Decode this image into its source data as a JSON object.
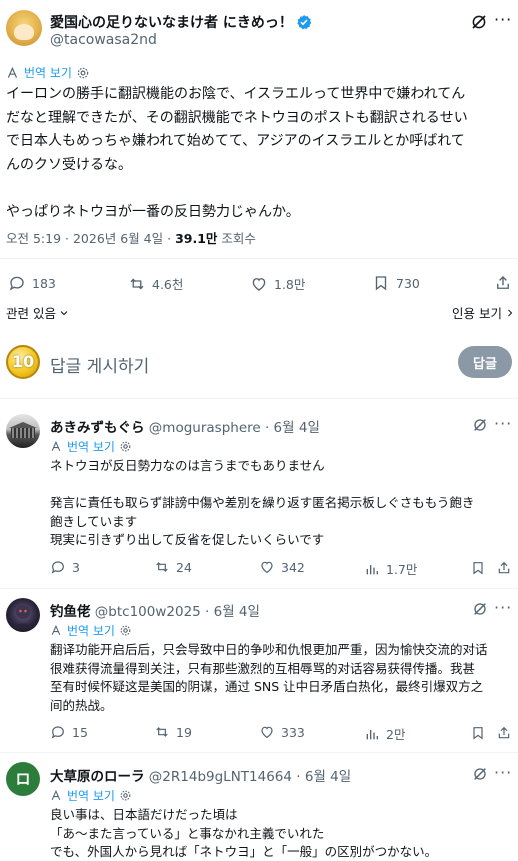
{
  "main_post": {
    "author_name": "愛国心の足りないなまけ者 にきめっ！",
    "author_handle": "@tacowasa2nd",
    "translate_label": "번역 보기",
    "body_lines": [
      "イーロンの勝手に翻訳機能のお陰で、イスラエルって世界中で嫌われてん",
      "だなと理解できたが、その翻訳機能でネトウヨのポストも翻訳されるせい",
      "で日本人もめっちゃ嫌われて始めてて、アジアのイスラエルとか呼ばれて",
      "んのクソ受けるな。",
      "",
      "やっぱりネトウヨが一番の反日勢力じゃんか。"
    ],
    "time": "오전 5:19 · 2026년 6월 4일 · ",
    "views_count": "39.1만",
    "views_label": " 조회수",
    "stats": {
      "replies": "183",
      "reposts": "4.6천",
      "likes": "1.8만",
      "bookmarks": "730"
    },
    "relevance_label": "관련 있음",
    "quotes_label": "인용 보기"
  },
  "reply_composer": {
    "badge_text": "10",
    "placeholder": "답글 게시하기",
    "button_label": "답글"
  },
  "replies": [
    {
      "name": "あきみずもぐら",
      "handle": "@mogurasphere",
      "date": " · 6월 4일",
      "translate_label": "번역 보기",
      "body_lines": [
        "ネトウヨが反日勢力なのは言うまでもありません",
        "",
        "発言に責任も取らず誹謗中傷や差別を繰り返す匿名掲示板しぐさももう飽き",
        "飽きしています",
        "現実に引きずり出して反省を促したいくらいです"
      ],
      "stats": {
        "replies": "3",
        "reposts": "24",
        "likes": "342",
        "views": "1.7만"
      }
    },
    {
      "name": "钓鱼佬",
      "handle": "@btc100w2025",
      "date": " · 6월 4일",
      "translate_label": "번역 보기",
      "body_lines": [
        "翻译功能开启后后，只会导致中日的争吵和仇恨更加严重，因为愉快交流的对话",
        "很难获得流量得到关注，只有那些激烈的互相辱骂的对话容易获得传播。我甚",
        "至有时候怀疑这是美国的阴谋，通过 SNS 让中日矛盾白热化，最终引爆双方之",
        "间的热战。"
      ],
      "stats": {
        "replies": "15",
        "reposts": "19",
        "likes": "333",
        "views": "2만"
      }
    },
    {
      "name": "大草原のローラ",
      "handle": "@2R14b9gLNT14664",
      "date": " · 6월 4일",
      "avatar_letter": "ロ",
      "translate_label": "번역 보기",
      "body_lines": [
        "良い事は、日本語だけだった頃は",
        "「あ〜また言っている」と事なかれ主義でいれた",
        "でも、外国人から見れば「ネトウヨ」と「一般」の区別がつかない。"
      ]
    }
  ],
  "colors": {
    "text": "#0f1419",
    "muted": "#536471",
    "link": "#1d9bf0",
    "divider": "#eff3f4",
    "verified": "#1d9bf0",
    "reply_button": "#8b98a5",
    "avatar_green": "#2d7d3a"
  }
}
